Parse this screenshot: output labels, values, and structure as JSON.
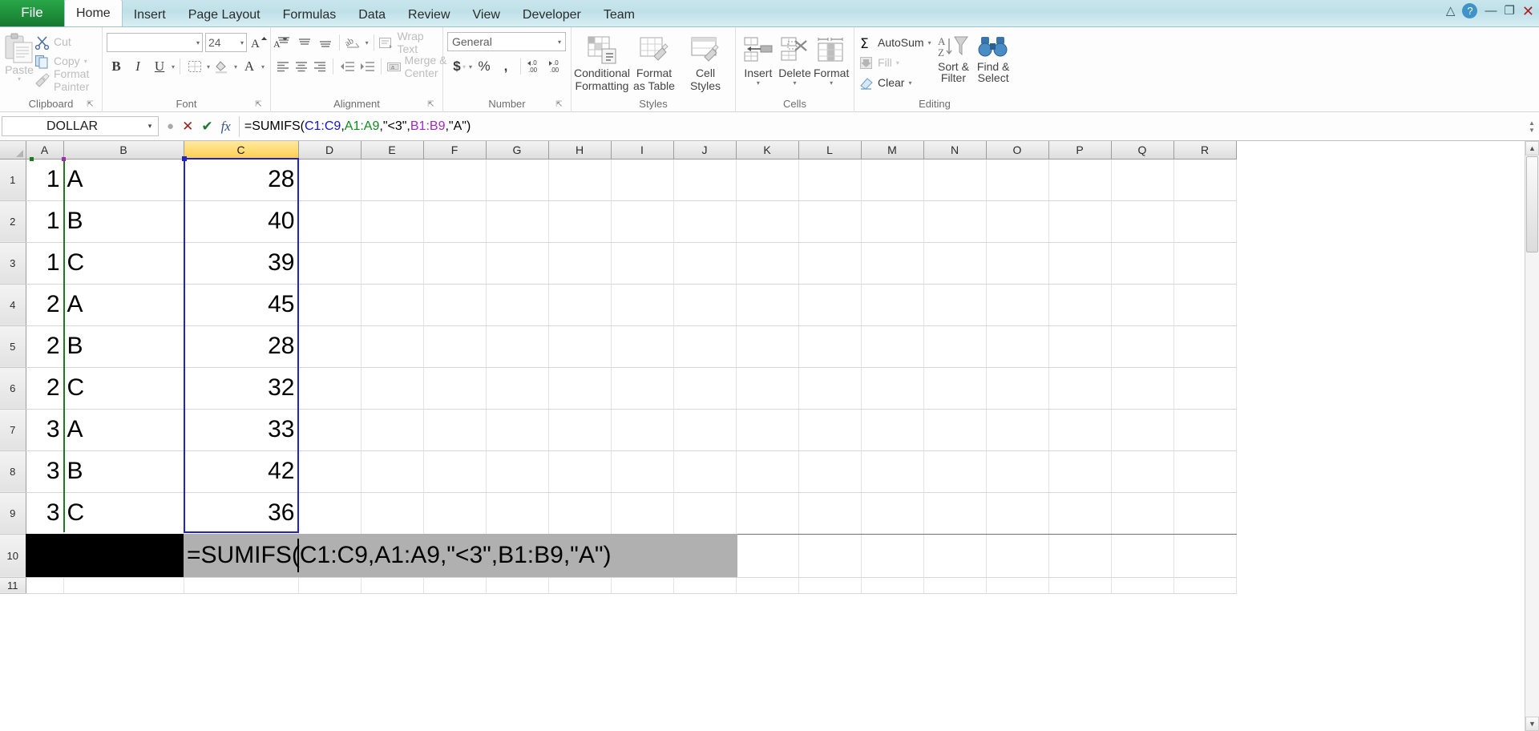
{
  "window": {
    "file_tab": "File",
    "tabs": [
      {
        "label": "Home",
        "active": true
      },
      {
        "label": "Insert",
        "active": false
      },
      {
        "label": "Page Layout",
        "active": false
      },
      {
        "label": "Formulas",
        "active": false
      },
      {
        "label": "Data",
        "active": false
      },
      {
        "label": "Review",
        "active": false
      },
      {
        "label": "View",
        "active": false
      },
      {
        "label": "Developer",
        "active": false
      },
      {
        "label": "Team",
        "active": false
      }
    ],
    "controls": {
      "ribbon_toggle": "△",
      "help": "?",
      "minimize": "—",
      "restore": "❐",
      "close": "✕"
    }
  },
  "ribbon": {
    "clipboard": {
      "title": "Clipboard",
      "paste": "Paste",
      "cut": "Cut",
      "copy": "Copy",
      "format_painter": "Format Painter",
      "dialog_launcher": "⬌"
    },
    "font": {
      "title": "Font",
      "font_name": "",
      "font_name_placeholder": "",
      "font_size": "24",
      "grow_font": "A",
      "shrink_font": "A",
      "bold": "B",
      "italic": "I",
      "underline": "U",
      "borders": "borders",
      "fill_color": "fill",
      "font_color": "A",
      "dialog_launcher": "⬌"
    },
    "alignment": {
      "title": "Alignment",
      "wrap_text": "Wrap Text",
      "merge_center": "Merge & Center",
      "dialog_launcher": "⬌"
    },
    "number": {
      "title": "Number",
      "format": "General",
      "currency": "$",
      "percent": "%",
      "comma": ",",
      "increase_decimal": ".00",
      "decrease_decimal": ".00",
      "dialog_launcher": "⬌"
    },
    "styles": {
      "title": "Styles",
      "conditional_formatting_l1": "Conditional",
      "conditional_formatting_l2": "Formatting",
      "format_as_table_l1": "Format",
      "format_as_table_l2": "as Table",
      "cell_styles_l1": "Cell",
      "cell_styles_l2": "Styles"
    },
    "cells": {
      "title": "Cells",
      "insert": "Insert",
      "delete": "Delete",
      "format": "Format"
    },
    "editing": {
      "title": "Editing",
      "autosum": "AutoSum",
      "fill": "Fill",
      "clear": "Clear",
      "sort_filter_l1": "Sort &",
      "sort_filter_l2": "Filter",
      "find_select_l1": "Find &",
      "find_select_l2": "Select"
    }
  },
  "formula_bar": {
    "name_box": "DOLLAR",
    "cancel_icon": "✕",
    "enter_icon": "✔",
    "function_icon": "fx",
    "formula_plain": "=SUMIFS(C1:C9,A1:A9,\"<3\",B1:B9,\"A\")",
    "formula_tokens": [
      {
        "text": "=SUMIFS(",
        "color": "black"
      },
      {
        "text": "C1:C9",
        "color": "blue"
      },
      {
        "text": ",",
        "color": "black"
      },
      {
        "text": "A1:A9",
        "color": "green"
      },
      {
        "text": ",\"<3\",",
        "color": "black"
      },
      {
        "text": "B1:B9",
        "color": "purple"
      },
      {
        "text": ",\"A\")",
        "color": "black"
      }
    ]
  },
  "sheet": {
    "columns": [
      "A",
      "B",
      "C",
      "D",
      "E",
      "F",
      "G",
      "H",
      "I",
      "J",
      "K",
      "L",
      "M",
      "N",
      "O",
      "P",
      "Q",
      "R"
    ],
    "selected_column": "C",
    "rows": [
      "1",
      "2",
      "3",
      "4",
      "5",
      "6",
      "7",
      "8",
      "9",
      "10",
      "11"
    ],
    "data": [
      {
        "row": "1",
        "A": "1",
        "B": "A",
        "C": "28"
      },
      {
        "row": "2",
        "A": "1",
        "B": "B",
        "C": "40"
      },
      {
        "row": "3",
        "A": "1",
        "B": "C",
        "C": "39"
      },
      {
        "row": "4",
        "A": "2",
        "B": "A",
        "C": "45"
      },
      {
        "row": "5",
        "A": "2",
        "B": "B",
        "C": "28"
      },
      {
        "row": "6",
        "A": "2",
        "B": "C",
        "C": "32"
      },
      {
        "row": "7",
        "A": "3",
        "B": "A",
        "C": "33"
      },
      {
        "row": "8",
        "A": "3",
        "B": "B",
        "C": "42"
      },
      {
        "row": "9",
        "A": "3",
        "B": "C",
        "C": "36"
      }
    ],
    "editing_cell": {
      "address": "A10",
      "text": "=SUMIFS(C1:C9,A1:A9,\"<3\",B1:B9,\"A\")"
    },
    "range_highlights": [
      {
        "range": "A1:A9",
        "color": "#1f7a1f"
      },
      {
        "range": "B1:B9",
        "color": "#9b2fae"
      },
      {
        "range": "C1:C9",
        "color": "#2222cc"
      }
    ]
  }
}
